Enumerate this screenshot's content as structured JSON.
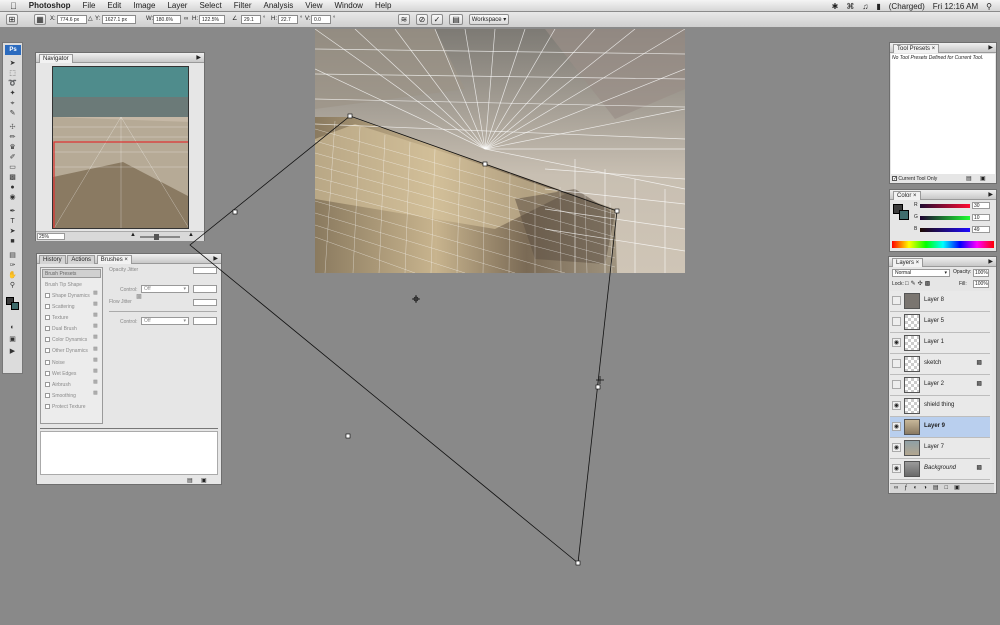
{
  "menubar": {
    "apple": "",
    "items": [
      "Photoshop",
      "File",
      "Edit",
      "Image",
      "Layer",
      "Select",
      "Filter",
      "Analysis",
      "View",
      "Window",
      "Help"
    ],
    "status": "(Charged)",
    "clock": "Fri 12:16 AM"
  },
  "options": {
    "x_value": "774.6 px",
    "y_value": "1627.1 px",
    "w_label": "W:",
    "w_value": "180.6%",
    "h_label": "H:",
    "h_value": "122.5%",
    "angle_value": "29.1",
    "h2_label": "H:",
    "h2_value": "22.7",
    "v_label": "V:",
    "v_value": "0.0",
    "workspace": "Workspace"
  },
  "tools": {
    "badge": "Ps"
  },
  "navigator": {
    "title": "Navigator",
    "zoom": "25%"
  },
  "brushes_panel": {
    "tabs": [
      "History",
      "Actions",
      "Brushes"
    ],
    "presets_label": "Brush Presets",
    "tip_shape": "Brush Tip Shape",
    "items": [
      "Shape Dynamics",
      "Scattering",
      "Texture",
      "Dual Brush",
      "Color Dynamics",
      "Other Dynamics",
      "Noise",
      "Wet Edges",
      "Airbrush",
      "Smoothing",
      "Protect Texture"
    ],
    "opacity_jitter": "Opacity Jitter",
    "control_label": "Control:",
    "control_value": "Off",
    "flow_jitter": "Flow Jitter",
    "control_label2": "Control:",
    "control_value2": "Off"
  },
  "tool_presets": {
    "title": "Tool Presets",
    "message": "No Tool Presets Defined for Current Tool.",
    "checkbox": "Current Tool Only"
  },
  "color_panel": {
    "title": "Color",
    "r_label": "R",
    "r_value": "30",
    "g_label": "G",
    "g_value": "10",
    "b_label": "B",
    "b_value": "49"
  },
  "layers_panel": {
    "title": "Layers",
    "blend_mode": "Normal",
    "opacity_label": "Opacity:",
    "opacity_value": "100%",
    "lock_label": "Lock:",
    "fill_label": "Fill:",
    "fill_value": "100%",
    "layers": [
      {
        "name": "Layer 8",
        "visible": false,
        "locked": false,
        "selected": false
      },
      {
        "name": "Layer 5",
        "visible": false,
        "locked": false,
        "selected": false
      },
      {
        "name": "Layer 1",
        "visible": true,
        "locked": false,
        "selected": false
      },
      {
        "name": "sketch",
        "visible": false,
        "locked": true,
        "selected": false
      },
      {
        "name": "Layer 2",
        "visible": false,
        "locked": true,
        "selected": false
      },
      {
        "name": "shield thing",
        "visible": true,
        "locked": false,
        "selected": false
      },
      {
        "name": "Layer 9",
        "visible": true,
        "locked": false,
        "selected": true
      },
      {
        "name": "Layer 7",
        "visible": true,
        "locked": false,
        "selected": false
      },
      {
        "name": "Background",
        "visible": true,
        "locked": true,
        "selected": false
      }
    ]
  }
}
